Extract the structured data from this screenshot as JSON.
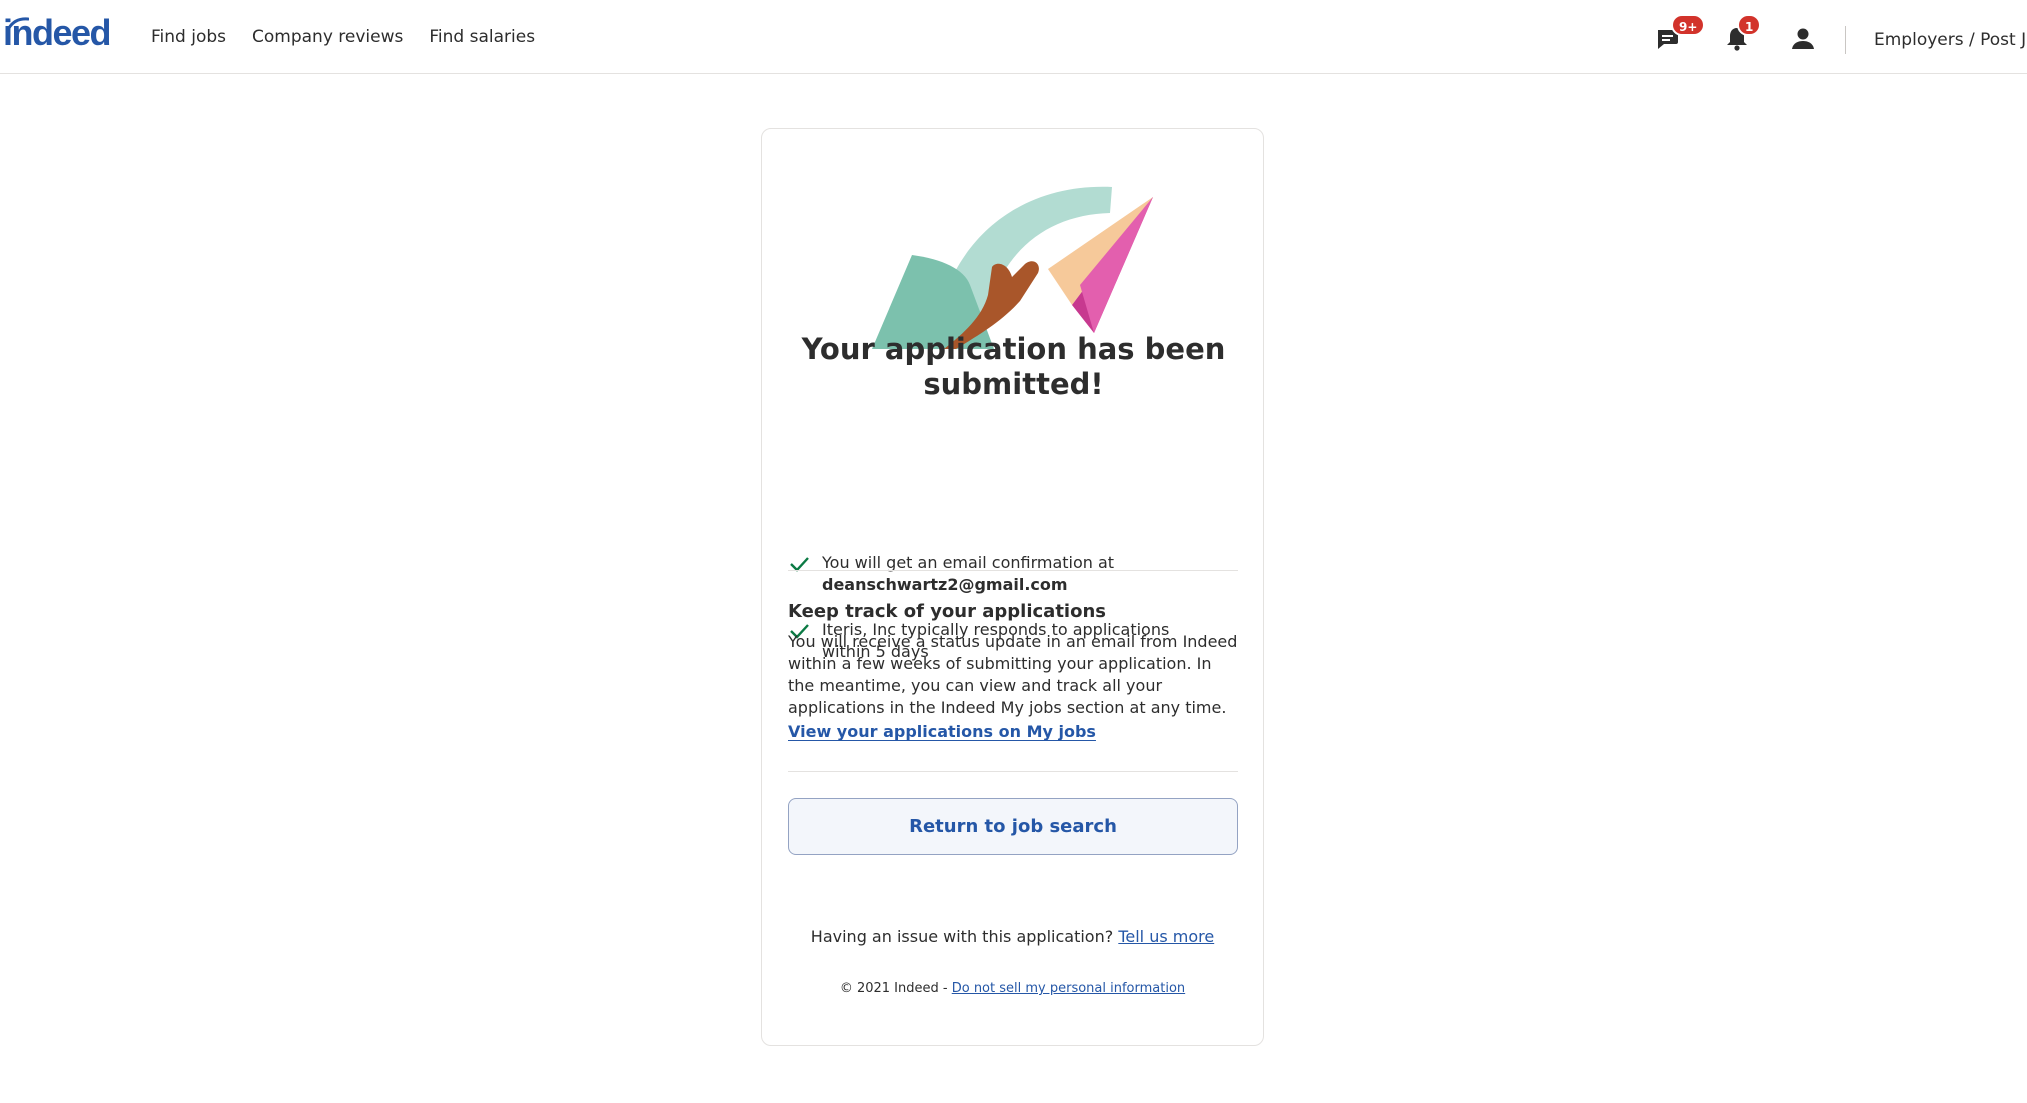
{
  "header": {
    "logo_text": "indeed",
    "nav": [
      {
        "label": "Find jobs"
      },
      {
        "label": "Company reviews"
      },
      {
        "label": "Find salaries"
      }
    ],
    "messages_badge": "9+",
    "notifications_badge": "1",
    "employers_label": "Employers / Post Job",
    "brand_color": "#2557a7",
    "badge_color": "#d2332b"
  },
  "card": {
    "title": "Your application has been submitted!",
    "confirmations": [
      {
        "text": "You will get an email confirmation at",
        "strong": "deanschwartz2@gmail.com"
      },
      {
        "text": "Iteris, Inc typically responds to applications within 5 days",
        "strong": ""
      }
    ],
    "track": {
      "title": "Keep track of your applications",
      "body": "You will receive a status update in an email from Indeed within a few weeks of submitting your application. In the meantime, you can view and track all your applications in the Indeed My jobs section at any time.",
      "link": "View your applications on My jobs"
    },
    "return_button": "Return to job search",
    "issue_text": "Having an issue with this application?",
    "issue_link": "Tell us more",
    "copyright": "© 2021 Indeed -",
    "privacy_link": "Do not sell my personal information"
  }
}
